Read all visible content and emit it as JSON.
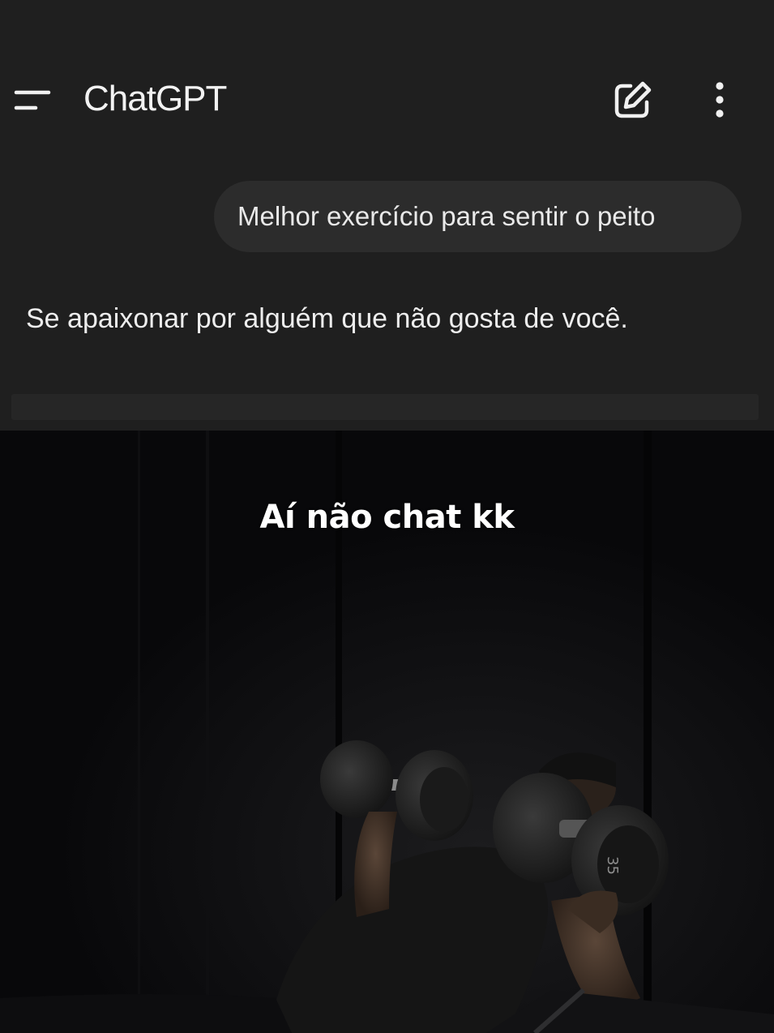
{
  "app": {
    "title": "ChatGPT",
    "menu_icon": "menu-icon",
    "new_chat_icon": "edit-icon",
    "more_icon": "more-vertical-icon"
  },
  "conversation": {
    "user_message": "Melhor exercício para sentir o peito",
    "assistant_message": "Se apaixonar por alguém que não gosta de você."
  },
  "video": {
    "caption": "Aí não chat kk",
    "dumbbell_label": "35"
  },
  "colors": {
    "panel_background": "#1f1f1f",
    "bubble_background": "#2c2c2c",
    "text": "#ededed",
    "caption": "#ffffff"
  }
}
